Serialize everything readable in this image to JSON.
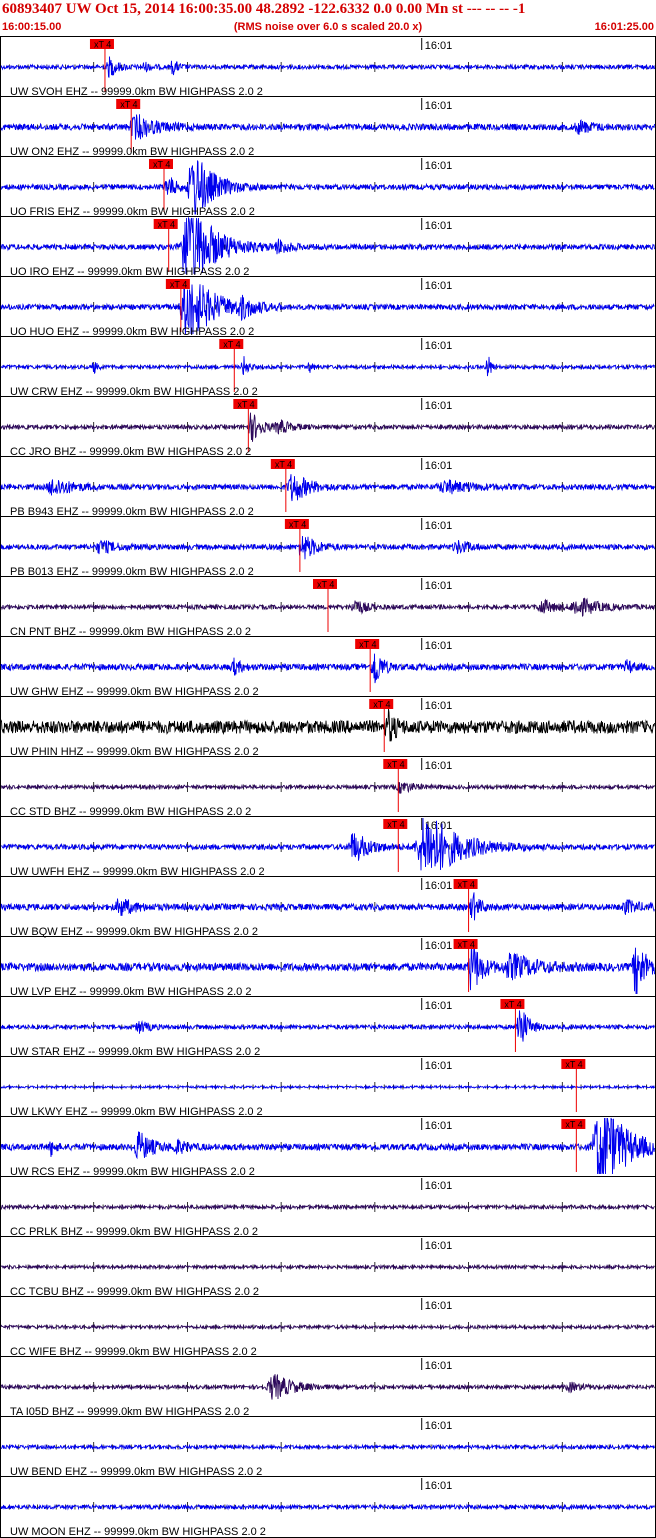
{
  "header": {
    "title": "60893407 UW Oct 15, 2014 16:00:35.00   48.2892 -122.6332  0.0 0.00 Mn st --- -- --  -1",
    "start_time": "16:00:15.00",
    "note": "(RMS noise over 6.0 s scaled 20.0 x)",
    "end_time": "16:01:25.00"
  },
  "chart_data": {
    "type": "line",
    "time_axis": {
      "start": "16:00:15.00",
      "end": "16:01:25.00",
      "duration_s": 70,
      "marker_label": "16:01",
      "marker_time_s": 45
    },
    "pick_label": "xT 4",
    "colors": {
      "blue": "#0000ee",
      "purple": "#2e0a5c",
      "black": "#000000",
      "pick": "#ee0000",
      "frame": "#000000"
    },
    "channels": [
      {
        "label": "UW SVOH EHZ -- 99999.0km BW  HIGHPASS  2.0  2",
        "pick_s": 11.2,
        "color": "blue",
        "noise": 0.08,
        "events": [
          [
            11.8,
            0.35,
            1.2
          ],
          [
            18.5,
            0.25,
            0.8
          ],
          [
            15.5,
            0.15,
            1.0
          ]
        ]
      },
      {
        "label": "UW ON2 EHZ -- 99999.0km BW  HIGHPASS  2.0  2",
        "pick_s": 14.0,
        "color": "blue",
        "noise": 0.12,
        "events": [
          [
            14.8,
            0.4,
            3.0
          ],
          [
            62.0,
            0.2,
            2.0
          ]
        ]
      },
      {
        "label": "UO FRIS EHZ -- 99999.0km BW  HIGHPASS  2.0  2",
        "pick_s": 17.5,
        "color": "blue",
        "noise": 0.1,
        "events": [
          [
            21.0,
            1.2,
            3.0
          ],
          [
            18.0,
            0.4,
            1.2
          ]
        ]
      },
      {
        "label": "UO IRO EHZ -- 99999.0km BW  HIGHPASS  2.0  2",
        "pick_s": 18.0,
        "color": "blue",
        "noise": 0.1,
        "events": [
          [
            20.5,
            1.6,
            4.0
          ],
          [
            30.0,
            0.2,
            2.0
          ]
        ]
      },
      {
        "label": "UO HUO EHZ -- 99999.0km BW  HIGHPASS  2.0  2",
        "pick_s": 19.3,
        "color": "blue",
        "noise": 0.1,
        "events": [
          [
            20.5,
            1.2,
            4.0
          ],
          [
            26.0,
            0.3,
            2.0
          ]
        ]
      },
      {
        "label": "UW CRW EHZ -- 99999.0km BW  HIGHPASS  2.0  2",
        "pick_s": 25.0,
        "color": "blue",
        "noise": 0.07,
        "events": [
          [
            26.0,
            0.4,
            0.6
          ],
          [
            10.0,
            0.3,
            0.3
          ],
          [
            52.0,
            0.6,
            0.4
          ],
          [
            33.0,
            0.2,
            0.5
          ]
        ]
      },
      {
        "label": "CC JRO BHZ -- 99999.0km BW  HIGHPASS  2.0  2",
        "pick_s": 26.5,
        "color": "purple",
        "noise": 0.08,
        "events": [
          [
            27.0,
            0.5,
            1.5
          ],
          [
            30.0,
            0.2,
            2.0
          ]
        ]
      },
      {
        "label": "PB B943 EHZ -- 99999.0km BW  HIGHPASS  2.0  2",
        "pick_s": 30.5,
        "color": "blue",
        "noise": 0.1,
        "events": [
          [
            31.5,
            0.5,
            2.5
          ],
          [
            6.0,
            0.3,
            3.0
          ],
          [
            48.0,
            0.2,
            4.0
          ]
        ]
      },
      {
        "label": "PB B013 EHZ -- 99999.0km BW  HIGHPASS  2.0  2",
        "pick_s": 32.0,
        "color": "blue",
        "noise": 0.1,
        "events": [
          [
            32.5,
            0.45,
            2.0
          ],
          [
            11.0,
            0.2,
            2.5
          ],
          [
            49.0,
            0.2,
            2.0
          ]
        ]
      },
      {
        "label": "CN PNT BHZ -- 99999.0km BW  HIGHPASS  2.0  2",
        "pick_s": 35.0,
        "color": "purple",
        "noise": 0.08,
        "events": [
          [
            38.0,
            0.3,
            1.5
          ],
          [
            62.0,
            0.3,
            3.5
          ],
          [
            58.0,
            0.25,
            2.0
          ]
        ]
      },
      {
        "label": "UW GHW EHZ -- 99999.0km BW  HIGHPASS  2.0  2",
        "pick_s": 39.5,
        "color": "blue",
        "noise": 0.12,
        "events": [
          [
            40.0,
            0.8,
            1.0
          ],
          [
            25.0,
            0.25,
            1.0
          ],
          [
            67.0,
            0.2,
            1.0
          ]
        ]
      },
      {
        "label": "UW PHIN HHZ -- 99999.0km BW  HIGHPASS  2.0  2",
        "pick_s": 41.0,
        "color": "black",
        "noise": 0.25,
        "events": [
          [
            41.5,
            0.5,
            1.0
          ]
        ]
      },
      {
        "label": "CC STD BHZ -- 99999.0km BW  HIGHPASS  2.0  2",
        "pick_s": 42.5,
        "color": "purple",
        "noise": 0.07,
        "events": [
          [
            43.0,
            0.2,
            2.0
          ]
        ]
      },
      {
        "label": "UW UWFH EHZ -- 99999.0km BW  HIGHPASS  2.0  2",
        "pick_s": 42.5,
        "color": "blue",
        "noise": 0.1,
        "events": [
          [
            46.0,
            1.2,
            5.0
          ],
          [
            38.0,
            0.5,
            2.5
          ]
        ]
      },
      {
        "label": "UW BQW EHZ -- 99999.0km BW  HIGHPASS  2.0  2",
        "pick_s": 50.0,
        "color": "blue",
        "noise": 0.12,
        "events": [
          [
            50.5,
            0.5,
            1.0
          ],
          [
            13.0,
            0.3,
            2.0
          ],
          [
            67.0,
            0.2,
            2.0
          ]
        ]
      },
      {
        "label": "UW LVP EHZ -- 99999.0km BW  HIGHPASS  2.0  2",
        "pick_s": 50.0,
        "color": "blue",
        "noise": 0.15,
        "events": [
          [
            50.5,
            0.9,
            1.5
          ],
          [
            55.0,
            0.4,
            4.0
          ],
          [
            68.0,
            1.0,
            1.5
          ]
        ]
      },
      {
        "label": "UW STAR EHZ -- 99999.0km BW  HIGHPASS  2.0  2",
        "pick_s": 55.0,
        "color": "blue",
        "noise": 0.08,
        "events": [
          [
            55.5,
            0.9,
            1.2
          ],
          [
            15.0,
            0.2,
            1.5
          ]
        ]
      },
      {
        "label": "UW LKWY EHZ -- 99999.0km BW  HIGHPASS  2.0  2",
        "pick_s": 61.5,
        "color": "blue",
        "noise": 0.04,
        "events": []
      },
      {
        "label": "UW RCS EHZ -- 99999.0km BW  HIGHPASS  2.0  2",
        "pick_s": 61.5,
        "color": "blue",
        "noise": 0.12,
        "events": [
          [
            64.5,
            1.6,
            4.0
          ],
          [
            15.0,
            0.5,
            2.0
          ],
          [
            5.5,
            0.3,
            0.5
          ],
          [
            19.0,
            0.2,
            1.5
          ]
        ]
      },
      {
        "label": "CC PRLK BHZ -- 99999.0km BW  HIGHPASS  2.0  2",
        "color": "purple",
        "noise": 0.07,
        "events": []
      },
      {
        "label": "CC TCBU BHZ -- 99999.0km BW  HIGHPASS  2.0  2",
        "color": "purple",
        "noise": 0.06,
        "events": []
      },
      {
        "label": "CC WIFE BHZ -- 99999.0km BW  HIGHPASS  2.0  2",
        "color": "purple",
        "noise": 0.06,
        "events": []
      },
      {
        "label": "TA I05D BHZ -- 99999.0km BW  HIGHPASS  2.0  2",
        "color": "purple",
        "noise": 0.07,
        "events": [
          [
            29.5,
            0.45,
            3.0
          ],
          [
            61.0,
            0.15,
            2.0
          ]
        ]
      },
      {
        "label": "UW BEND EHZ -- 99999.0km BW  HIGHPASS  2.0  2",
        "color": "blue",
        "noise": 0.07,
        "events": []
      },
      {
        "label": "UW MOON EHZ -- 99999.0km BW  HIGHPASS  2.0  2",
        "color": "blue",
        "noise": 0.08,
        "events": []
      }
    ]
  }
}
